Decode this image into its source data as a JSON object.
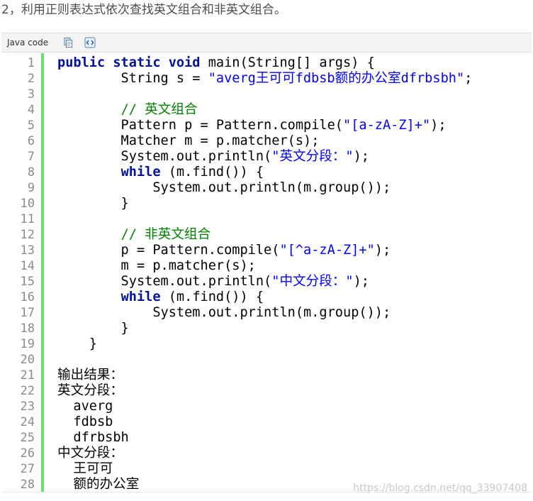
{
  "heading": "2，利用正则表达式依次查找英文组合和非英文组合。",
  "toolbar": {
    "language_label": "Java code",
    "copy_icon": "copy-icon",
    "view_source_icon": "view-source-icon"
  },
  "colors": {
    "keyword": "#00119e",
    "string": "#0000ff",
    "comment": "#008200",
    "gutter_bar": "#6ce26c"
  },
  "code_lines": [
    {
      "n": "1",
      "parts": [
        {
          "t": "public static void",
          "c": "kw"
        },
        {
          "t": " main(String[] args) {"
        }
      ]
    },
    {
      "n": "2",
      "parts": [
        {
          "t": "        String s = "
        },
        {
          "t": "\"averg王可可fdbsb额的办公室dfrbsbh\"",
          "c": "str"
        },
        {
          "t": ";"
        }
      ]
    },
    {
      "n": "3",
      "parts": []
    },
    {
      "n": "4",
      "parts": [
        {
          "t": "        "
        },
        {
          "t": "// 英文组合",
          "c": "cm"
        }
      ]
    },
    {
      "n": "5",
      "parts": [
        {
          "t": "        Pattern p = Pattern.compile("
        },
        {
          "t": "\"[a-zA-Z]+\"",
          "c": "str"
        },
        {
          "t": ");"
        }
      ]
    },
    {
      "n": "6",
      "parts": [
        {
          "t": "        Matcher m = p.matcher(s);"
        }
      ]
    },
    {
      "n": "7",
      "parts": [
        {
          "t": "        System.out.println("
        },
        {
          "t": "\"英文分段：\"",
          "c": "str"
        },
        {
          "t": ");"
        }
      ]
    },
    {
      "n": "8",
      "parts": [
        {
          "t": "        "
        },
        {
          "t": "while",
          "c": "kw"
        },
        {
          "t": " (m.find()) {"
        }
      ]
    },
    {
      "n": "9",
      "parts": [
        {
          "t": "            System.out.println(m.group());"
        }
      ]
    },
    {
      "n": "10",
      "parts": [
        {
          "t": "        }"
        }
      ]
    },
    {
      "n": "11",
      "parts": []
    },
    {
      "n": "12",
      "parts": [
        {
          "t": "        "
        },
        {
          "t": "// 非英文组合",
          "c": "cm"
        }
      ]
    },
    {
      "n": "13",
      "parts": [
        {
          "t": "        p = Pattern.compile("
        },
        {
          "t": "\"[^a-zA-Z]+\"",
          "c": "str"
        },
        {
          "t": ");"
        }
      ]
    },
    {
      "n": "14",
      "parts": [
        {
          "t": "        m = p.matcher(s);"
        }
      ]
    },
    {
      "n": "15",
      "parts": [
        {
          "t": "        System.out.println("
        },
        {
          "t": "\"中文分段：\"",
          "c": "str"
        },
        {
          "t": ");"
        }
      ]
    },
    {
      "n": "16",
      "parts": [
        {
          "t": "        "
        },
        {
          "t": "while",
          "c": "kw"
        },
        {
          "t": " (m.find()) {"
        }
      ]
    },
    {
      "n": "17",
      "parts": [
        {
          "t": "            System.out.println(m.group());"
        }
      ]
    },
    {
      "n": "18",
      "parts": [
        {
          "t": "        }"
        }
      ]
    },
    {
      "n": "19",
      "parts": [
        {
          "t": "    }"
        }
      ]
    },
    {
      "n": "20",
      "parts": []
    },
    {
      "n": "21",
      "parts": [
        {
          "t": "输出结果："
        }
      ]
    },
    {
      "n": "22",
      "parts": [
        {
          "t": "英文分段："
        }
      ]
    },
    {
      "n": "23",
      "parts": [
        {
          "t": "  averg"
        }
      ]
    },
    {
      "n": "24",
      "parts": [
        {
          "t": "  fdbsb"
        }
      ]
    },
    {
      "n": "25",
      "parts": [
        {
          "t": "  dfrbsbh"
        }
      ]
    },
    {
      "n": "26",
      "parts": [
        {
          "t": "中文分段："
        }
      ]
    },
    {
      "n": "27",
      "parts": [
        {
          "t": "  王可可"
        }
      ]
    },
    {
      "n": "28",
      "parts": [
        {
          "t": "  额的办公室"
        }
      ]
    }
  ],
  "watermark": "https://blog.csdn.net/qq_33907408"
}
